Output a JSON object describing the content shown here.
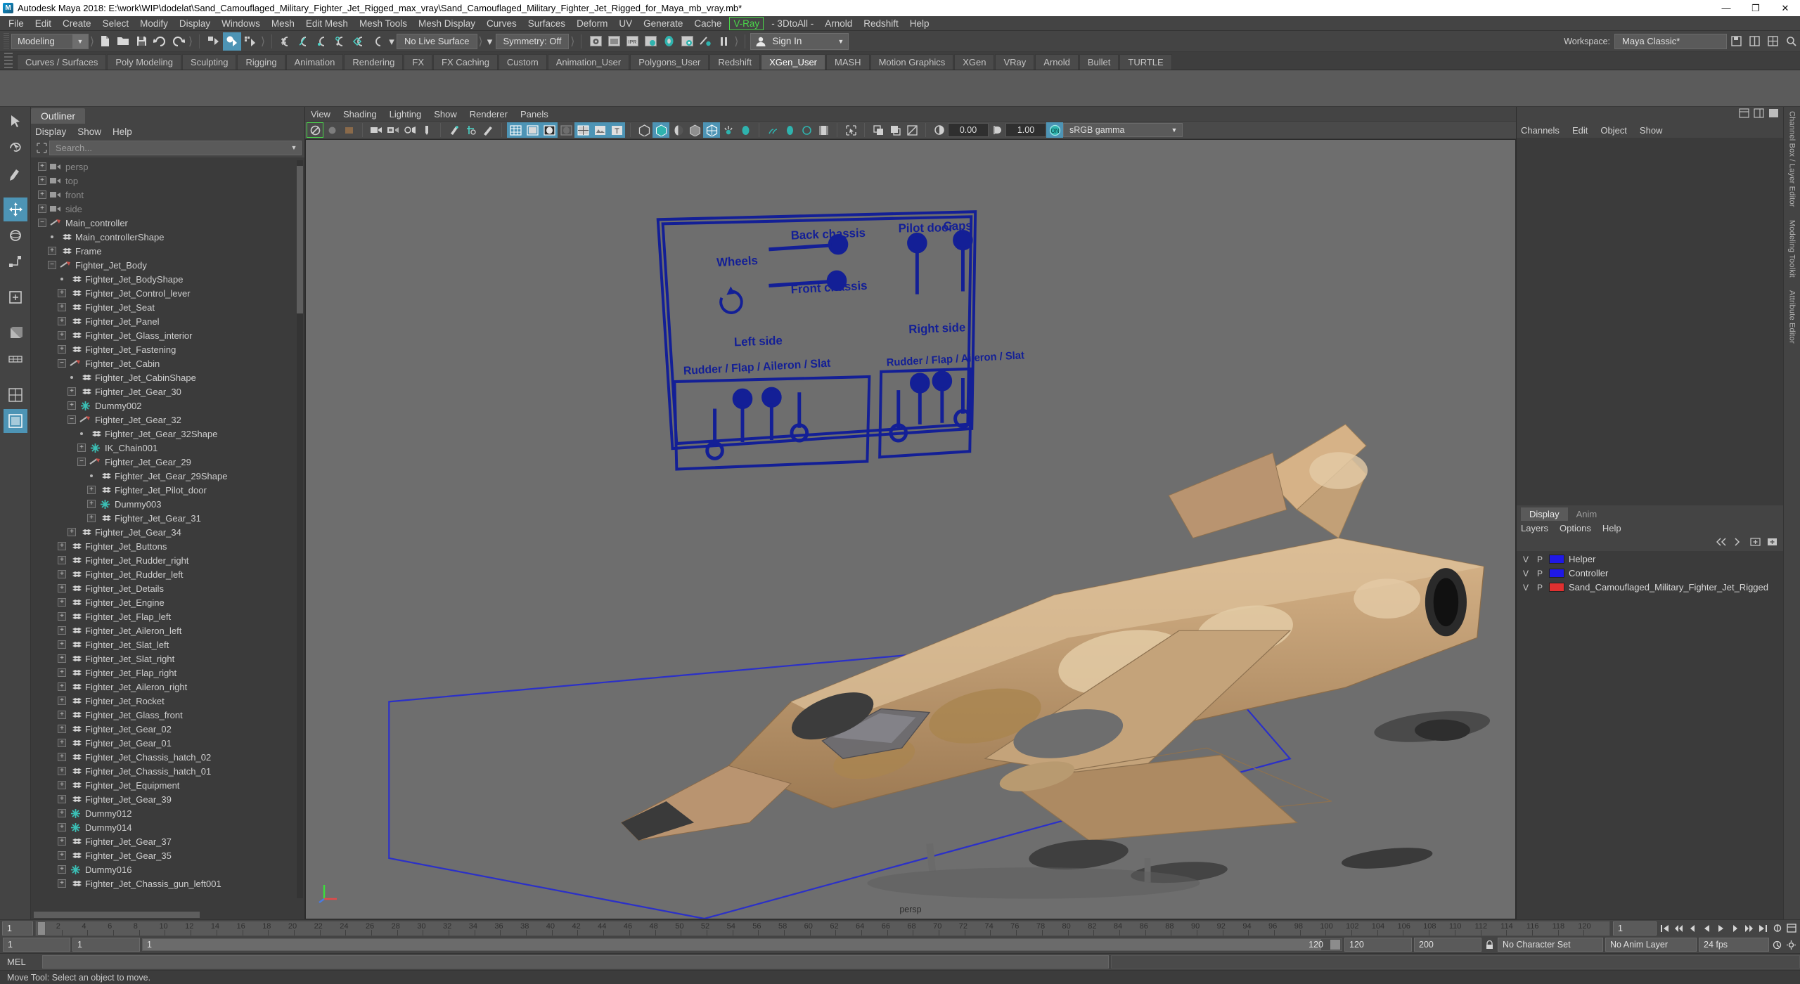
{
  "window": {
    "title": "Autodesk Maya 2018: E:\\work\\WIP\\dodelat\\Sand_Camouflaged_Military_Fighter_Jet_Rigged_max_vray\\Sand_Camouflaged_Military_Fighter_Jet_Rigged_for_Maya_mb_vray.mb*",
    "minimize": "—",
    "maximize": "❐",
    "close": "✕"
  },
  "menubar": {
    "items": [
      {
        "label": "File"
      },
      {
        "label": "Edit"
      },
      {
        "label": "Create"
      },
      {
        "label": "Select"
      },
      {
        "label": "Modify"
      },
      {
        "label": "Display"
      },
      {
        "label": "Windows"
      },
      {
        "label": "Mesh"
      },
      {
        "label": "Edit Mesh"
      },
      {
        "label": "Mesh Tools"
      },
      {
        "label": "Mesh Display"
      },
      {
        "label": "Curves"
      },
      {
        "label": "Surfaces"
      },
      {
        "label": "Deform"
      },
      {
        "label": "UV"
      },
      {
        "label": "Generate"
      },
      {
        "label": "Cache"
      },
      {
        "label": "V-Ray",
        "style": "vray"
      },
      {
        "label": "- 3DtoAll -"
      },
      {
        "label": "Arnold"
      },
      {
        "label": "Redshift"
      },
      {
        "label": "Help"
      }
    ]
  },
  "toolbar": {
    "menuset": "Modeling",
    "live_surface": "No Live Surface",
    "symmetry": "Symmetry: Off",
    "signin": "Sign In",
    "workspace_label": "Workspace:",
    "workspace_value": "Maya Classic*",
    "icons": [
      "new-scene-icon",
      "open-scene-icon",
      "save-scene-icon",
      "undo-icon",
      "redo-icon",
      "select-by-hierarchy-icon",
      "select-by-object-icon",
      "select-by-component-icon",
      "snap-to-grid-icon",
      "snap-to-curve-icon",
      "snap-to-point-icon",
      "snap-to-projected-center-icon",
      "snap-to-view-plane-icon",
      "make-live-icon",
      "render-current-frame-icon",
      "render-sequence-icon",
      "ipr-render-icon",
      "render-settings-icon",
      "hypershade-icon",
      "render-view-icon",
      "rendering-flags-icon",
      "pause-render-icon"
    ]
  },
  "shelf": {
    "tabs": [
      {
        "label": "Curves / Surfaces",
        "active": false
      },
      {
        "label": "Poly Modeling",
        "active": false
      },
      {
        "label": "Sculpting",
        "active": false
      },
      {
        "label": "Rigging",
        "active": false
      },
      {
        "label": "Animation",
        "active": false
      },
      {
        "label": "Rendering",
        "active": false
      },
      {
        "label": "FX",
        "active": false
      },
      {
        "label": "FX Caching",
        "active": false
      },
      {
        "label": "Custom",
        "active": false
      },
      {
        "label": "Animation_User",
        "active": false
      },
      {
        "label": "Polygons_User",
        "active": false
      },
      {
        "label": "Redshift",
        "active": false
      },
      {
        "label": "XGen_User",
        "active": true
      },
      {
        "label": "MASH",
        "active": false
      },
      {
        "label": "Motion Graphics",
        "active": false
      },
      {
        "label": "XGen",
        "active": false
      },
      {
        "label": "VRay",
        "active": false
      },
      {
        "label": "Arnold",
        "active": false
      },
      {
        "label": "Bullet",
        "active": false
      },
      {
        "label": "TURTLE",
        "active": false
      }
    ]
  },
  "left_rail": {
    "icons": [
      "select-tool-icon",
      "lasso-select-tool-icon",
      "paint-select-tool-icon",
      "move-tool-icon",
      "rotate-tool-icon",
      "scale-tool-icon",
      "soft-mod-tool-icon",
      "show-manipulator-tool-icon",
      "last-tool-icon",
      "view-cube-icon",
      "axis-icon",
      "grid-icon"
    ]
  },
  "outliner": {
    "tab": "Outliner",
    "menus": [
      "Display",
      "Show",
      "Help"
    ],
    "search_placeholder": "Search...",
    "search_value": "",
    "tree": [
      {
        "label": "persp",
        "depth": 0,
        "expander": "+",
        "icon": "camera-icon",
        "dim": true
      },
      {
        "label": "top",
        "depth": 0,
        "expander": "+",
        "icon": "camera-icon",
        "dim": true
      },
      {
        "label": "front",
        "depth": 0,
        "expander": "+",
        "icon": "camera-icon",
        "dim": true
      },
      {
        "label": "side",
        "depth": 0,
        "expander": "+",
        "icon": "camera-icon",
        "dim": true
      },
      {
        "label": "Main_controller",
        "depth": 0,
        "expander": "-",
        "icon": "transform-icon",
        "dim": false
      },
      {
        "label": "Main_controllerShape",
        "depth": 1,
        "expander": "dot",
        "icon": "mesh-icon",
        "dim": false
      },
      {
        "label": "Frame",
        "depth": 1,
        "expander": "+",
        "icon": "mesh-icon",
        "dim": false
      },
      {
        "label": "Fighter_Jet_Body",
        "depth": 1,
        "expander": "-",
        "icon": "transform-icon",
        "dim": false
      },
      {
        "label": "Fighter_Jet_BodyShape",
        "depth": 2,
        "expander": "dot",
        "icon": "mesh-icon",
        "dim": false
      },
      {
        "label": "Fighter_Jet_Control_lever",
        "depth": 2,
        "expander": "+",
        "icon": "mesh-icon",
        "dim": false
      },
      {
        "label": "Fighter_Jet_Seat",
        "depth": 2,
        "expander": "+",
        "icon": "mesh-icon",
        "dim": false
      },
      {
        "label": "Fighter_Jet_Panel",
        "depth": 2,
        "expander": "+",
        "icon": "mesh-icon",
        "dim": false
      },
      {
        "label": "Fighter_Jet_Glass_interior",
        "depth": 2,
        "expander": "+",
        "icon": "mesh-icon",
        "dim": false
      },
      {
        "label": "Fighter_Jet_Fastening",
        "depth": 2,
        "expander": "+",
        "icon": "mesh-icon",
        "dim": false
      },
      {
        "label": "Fighter_Jet_Cabin",
        "depth": 2,
        "expander": "-",
        "icon": "transform-icon",
        "dim": false
      },
      {
        "label": "Fighter_Jet_CabinShape",
        "depth": 3,
        "expander": "dot",
        "icon": "mesh-icon",
        "dim": false
      },
      {
        "label": "Fighter_Jet_Gear_30",
        "depth": 3,
        "expander": "+",
        "icon": "mesh-icon",
        "dim": false
      },
      {
        "label": "Dummy002",
        "depth": 3,
        "expander": "+",
        "icon": "joint-icon",
        "dim": false
      },
      {
        "label": "Fighter_Jet_Gear_32",
        "depth": 3,
        "expander": "-",
        "icon": "transform-icon",
        "dim": false
      },
      {
        "label": "Fighter_Jet_Gear_32Shape",
        "depth": 4,
        "expander": "dot",
        "icon": "mesh-icon",
        "dim": false
      },
      {
        "label": "IK_Chain001",
        "depth": 4,
        "expander": "+",
        "icon": "joint-icon",
        "dim": false
      },
      {
        "label": "Fighter_Jet_Gear_29",
        "depth": 4,
        "expander": "-",
        "icon": "transform-icon",
        "dim": false
      },
      {
        "label": "Fighter_Jet_Gear_29Shape",
        "depth": 5,
        "expander": "dot",
        "icon": "mesh-icon",
        "dim": false
      },
      {
        "label": "Fighter_Jet_Pilot_door",
        "depth": 5,
        "expander": "+",
        "icon": "mesh-icon",
        "dim": false
      },
      {
        "label": "Dummy003",
        "depth": 5,
        "expander": "+",
        "icon": "joint-icon",
        "dim": false
      },
      {
        "label": "Fighter_Jet_Gear_31",
        "depth": 5,
        "expander": "+",
        "icon": "mesh-icon",
        "dim": false
      },
      {
        "label": "Fighter_Jet_Gear_34",
        "depth": 3,
        "expander": "+",
        "icon": "mesh-icon",
        "dim": false
      },
      {
        "label": "Fighter_Jet_Buttons",
        "depth": 2,
        "expander": "+",
        "icon": "mesh-icon",
        "dim": false
      },
      {
        "label": "Fighter_Jet_Rudder_right",
        "depth": 2,
        "expander": "+",
        "icon": "mesh-icon",
        "dim": false
      },
      {
        "label": "Fighter_Jet_Rudder_left",
        "depth": 2,
        "expander": "+",
        "icon": "mesh-icon",
        "dim": false
      },
      {
        "label": "Fighter_Jet_Details",
        "depth": 2,
        "expander": "+",
        "icon": "mesh-icon",
        "dim": false
      },
      {
        "label": "Fighter_Jet_Engine",
        "depth": 2,
        "expander": "+",
        "icon": "mesh-icon",
        "dim": false
      },
      {
        "label": "Fighter_Jet_Flap_left",
        "depth": 2,
        "expander": "+",
        "icon": "mesh-icon",
        "dim": false
      },
      {
        "label": "Fighter_Jet_Aileron_left",
        "depth": 2,
        "expander": "+",
        "icon": "mesh-icon",
        "dim": false
      },
      {
        "label": "Fighter_Jet_Slat_left",
        "depth": 2,
        "expander": "+",
        "icon": "mesh-icon",
        "dim": false
      },
      {
        "label": "Fighter_Jet_Slat_right",
        "depth": 2,
        "expander": "+",
        "icon": "mesh-icon",
        "dim": false
      },
      {
        "label": "Fighter_Jet_Flap_right",
        "depth": 2,
        "expander": "+",
        "icon": "mesh-icon",
        "dim": false
      },
      {
        "label": "Fighter_Jet_Aileron_right",
        "depth": 2,
        "expander": "+",
        "icon": "mesh-icon",
        "dim": false
      },
      {
        "label": "Fighter_Jet_Rocket",
        "depth": 2,
        "expander": "+",
        "icon": "mesh-icon",
        "dim": false
      },
      {
        "label": "Fighter_Jet_Glass_front",
        "depth": 2,
        "expander": "+",
        "icon": "mesh-icon",
        "dim": false
      },
      {
        "label": "Fighter_Jet_Gear_02",
        "depth": 2,
        "expander": "+",
        "icon": "mesh-icon",
        "dim": false
      },
      {
        "label": "Fighter_Jet_Gear_01",
        "depth": 2,
        "expander": "+",
        "icon": "mesh-icon",
        "dim": false
      },
      {
        "label": "Fighter_Jet_Chassis_hatch_02",
        "depth": 2,
        "expander": "+",
        "icon": "mesh-icon",
        "dim": false
      },
      {
        "label": "Fighter_Jet_Chassis_hatch_01",
        "depth": 2,
        "expander": "+",
        "icon": "mesh-icon",
        "dim": false
      },
      {
        "label": "Fighter_Jet_Equipment",
        "depth": 2,
        "expander": "+",
        "icon": "mesh-icon",
        "dim": false
      },
      {
        "label": "Fighter_Jet_Gear_39",
        "depth": 2,
        "expander": "+",
        "icon": "mesh-icon",
        "dim": false
      },
      {
        "label": "Dummy012",
        "depth": 2,
        "expander": "+",
        "icon": "joint-icon",
        "dim": false
      },
      {
        "label": "Dummy014",
        "depth": 2,
        "expander": "+",
        "icon": "joint-icon",
        "dim": false
      },
      {
        "label": "Fighter_Jet_Gear_37",
        "depth": 2,
        "expander": "+",
        "icon": "mesh-icon",
        "dim": false
      },
      {
        "label": "Fighter_Jet_Gear_35",
        "depth": 2,
        "expander": "+",
        "icon": "mesh-icon",
        "dim": false
      },
      {
        "label": "Dummy016",
        "depth": 2,
        "expander": "+",
        "icon": "joint-icon",
        "dim": false
      },
      {
        "label": "Fighter_Jet_Chassis_gun_left001",
        "depth": 2,
        "expander": "+",
        "icon": "mesh-icon",
        "dim": false
      }
    ]
  },
  "viewport": {
    "menus": [
      "View",
      "Shading",
      "Lighting",
      "Show",
      "Renderer",
      "Panels"
    ],
    "exposure": "0.00",
    "gamma": "1.00",
    "color_space": "sRGB gamma",
    "camera_label": "persp"
  },
  "rig_panel": {
    "labels": {
      "wheels": "Wheels",
      "back_chassis": "Back chassis",
      "front_chassis": "Front chassis",
      "pilot_door": "Pilot door",
      "caps": "Caps",
      "left_side": "Left side",
      "right_side": "Right side",
      "left_group": "Rudder / Flap / Aileron / Slat",
      "right_group": "Rudder / Flap / Aileron / Slat"
    },
    "color": "#131f96"
  },
  "channelbox": {
    "tabs": [
      "Channels",
      "Edit",
      "Object",
      "Show"
    ],
    "side_labels": [
      "Channel Box / Layer Editor",
      "Modeling Toolkit",
      "Attribute Editor"
    ]
  },
  "layers": {
    "tabs": [
      {
        "label": "Display",
        "active": true
      },
      {
        "label": "Anim",
        "active": false
      }
    ],
    "menus": [
      "Layers",
      "Options",
      "Help"
    ],
    "columns": [
      "V",
      "P",
      "color",
      "name"
    ],
    "rows": [
      {
        "v": "V",
        "p": "P",
        "color": "#1f18e6",
        "name": "Helper"
      },
      {
        "v": "V",
        "p": "P",
        "color": "#1f18e6",
        "name": "Controller"
      },
      {
        "v": "V",
        "p": "P",
        "color": "#e03030",
        "name": "Sand_Camouflaged_Military_Fighter_Jet_Rigged"
      }
    ]
  },
  "timeline": {
    "current_frame": "1",
    "start_field": "1",
    "end_visible": "120",
    "range_start": "1",
    "range_end": "120",
    "playback_start": "120",
    "playback_end": "200",
    "character_set": "No Character Set",
    "anim_layer": "No Anim Layer",
    "fps": "24 fps",
    "ticks": [
      "2",
      "4",
      "6",
      "8",
      "10",
      "12",
      "14",
      "16",
      "18",
      "20",
      "22",
      "24",
      "26",
      "28",
      "30",
      "32",
      "34",
      "36",
      "38",
      "40",
      "42",
      "44",
      "46",
      "48",
      "50",
      "52",
      "54",
      "56",
      "58",
      "60",
      "62",
      "64",
      "66",
      "68",
      "70",
      "72",
      "74",
      "76",
      "78",
      "80",
      "82",
      "84",
      "86",
      "88",
      "90",
      "92",
      "94",
      "96",
      "98",
      "100",
      "102",
      "104",
      "106",
      "108",
      "110",
      "112",
      "114",
      "116",
      "118",
      "120"
    ]
  },
  "command_line": {
    "prompt": "MEL",
    "value": ""
  },
  "status_line": {
    "message": "Move Tool: Select an object to move."
  }
}
